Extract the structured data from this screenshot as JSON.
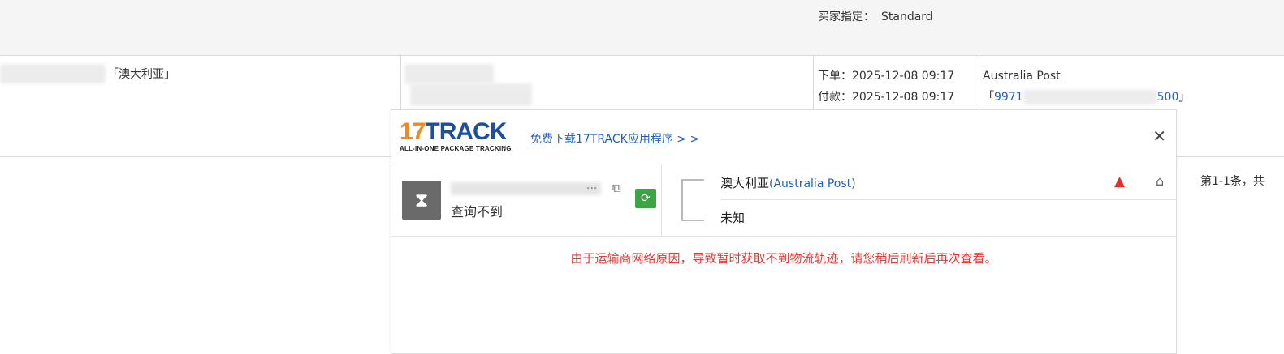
{
  "header": {
    "buyer_spec_label": "买家指定：",
    "buyer_spec_value": "Standard"
  },
  "order_row": {
    "country": "「澳大利亚」",
    "order_time": "下单：2025-12-08 09:17",
    "payment_time": "付款：2025-12-08 09:17",
    "carrier": "Australia Post",
    "tracking_bracket_open": "「",
    "tracking_prefix": "9971",
    "tracking_suffix": "500",
    "tracking_bracket_close": "」"
  },
  "pagination": {
    "text": "第1-1条，共"
  },
  "popup": {
    "logo_number": "17",
    "logo_word": "TRACK",
    "logo_tagline": "ALL-IN-ONE PACKAGE TRACKING",
    "download_link": "免费下载17TRACK应用程序 > >",
    "close_icon": "close-icon",
    "status_icon": "hourglass-icon",
    "tracking_ellipsis": "...",
    "status_text": "查询不到",
    "carrier_cn": "澳大利亚",
    "carrier_en": "(Australia Post)",
    "carrier_status": "未知",
    "error_message": "由于运输商网络原因，导致暂时获取不到物流轨迹，请您稍后刷新后再次查看。",
    "colors": {
      "link": "#1f5fbf",
      "error": "#e53935",
      "refresh": "#3ba546",
      "logo_orange": "#f08a1c",
      "logo_blue": "#1d4f9c"
    }
  }
}
